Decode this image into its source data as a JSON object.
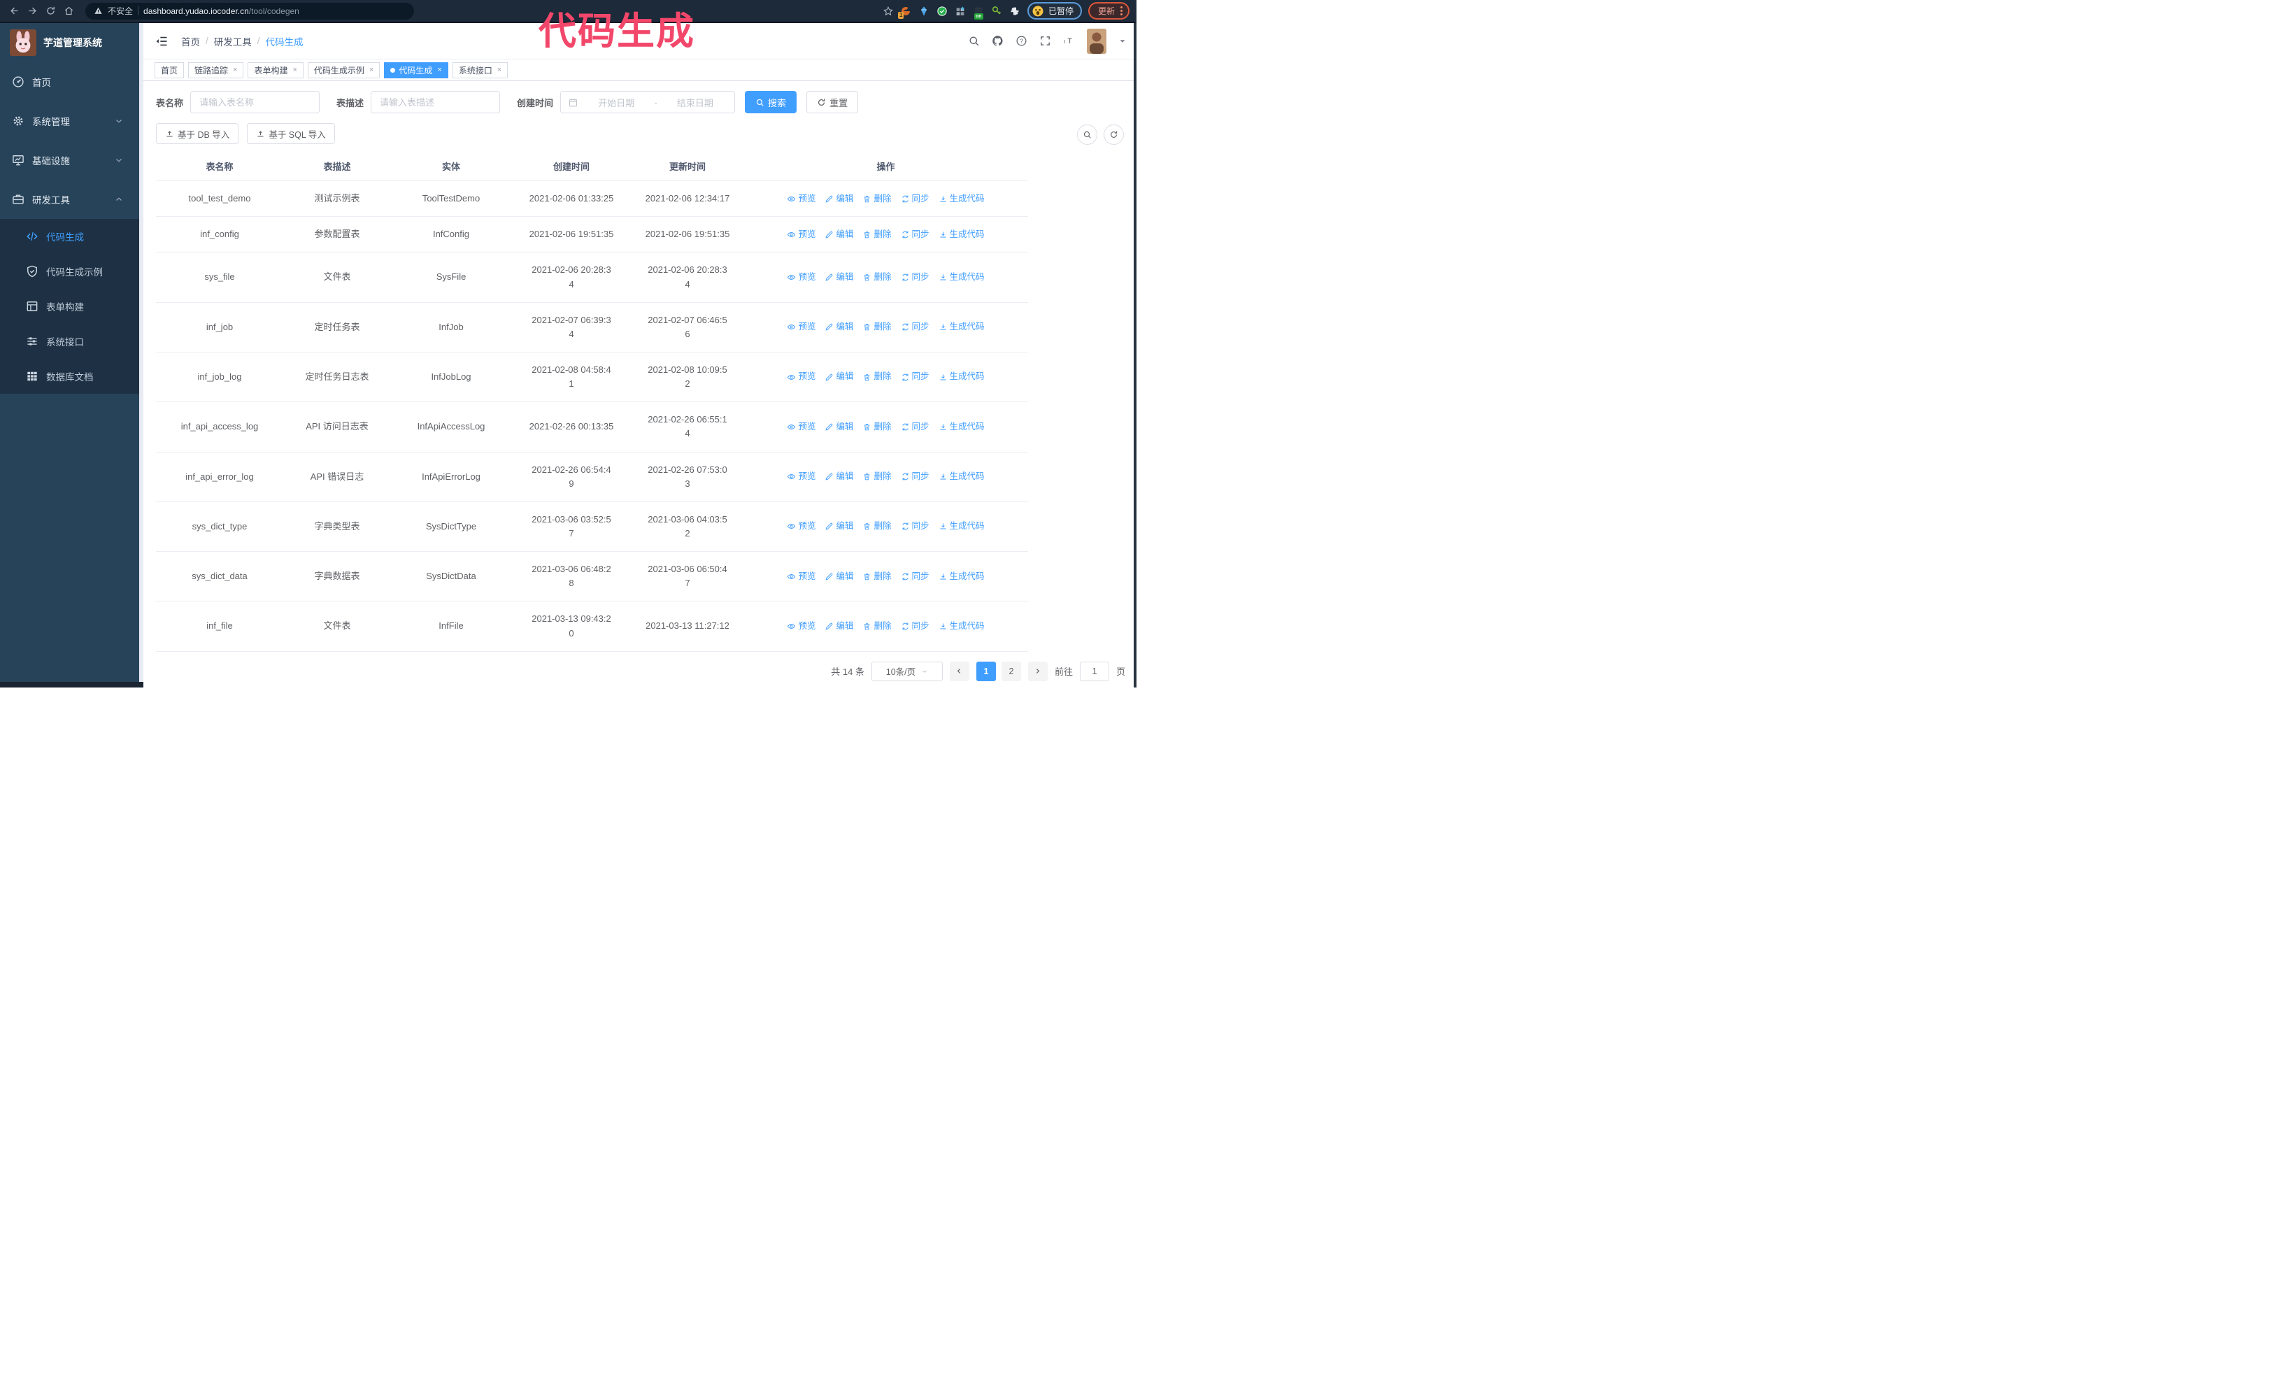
{
  "colors": {
    "accent": "#409EFF",
    "annotation": "#f2476a",
    "chrome": "#1d2a39",
    "sidebar": "#274359",
    "submenu": "#1e3144"
  },
  "annotation": {
    "text": "代码生成"
  },
  "browser": {
    "security_label": "不安全",
    "url_host": "dashboard.yudao.iocoder.cn",
    "url_path": "/tool/codegen",
    "extension_badge": "1",
    "extension_on_badge": "on",
    "paused_chip": "已暂停",
    "update_button": "更新"
  },
  "sidebar": {
    "logo_title": "芋道管理系统",
    "items": [
      {
        "label": "首页",
        "icon": "dashboard",
        "chevron": ""
      },
      {
        "label": "系统管理",
        "icon": "gear",
        "chevron": "down"
      },
      {
        "label": "基础设施",
        "icon": "monitor",
        "chevron": "down"
      },
      {
        "label": "研发工具",
        "icon": "toolbox",
        "chevron": "up"
      }
    ],
    "subitems": [
      {
        "label": "代码生成",
        "icon": "code",
        "active": true
      },
      {
        "label": "代码生成示例",
        "icon": "shield",
        "active": false
      },
      {
        "label": "表单构建",
        "icon": "form",
        "active": false
      },
      {
        "label": "系统接口",
        "icon": "sliders",
        "active": false
      },
      {
        "label": "数据库文档",
        "icon": "database",
        "active": false
      }
    ]
  },
  "breadcrumb": [
    "首页",
    "研发工具",
    "代码生成"
  ],
  "tabs": [
    {
      "label": "首页",
      "closable": false,
      "active": false
    },
    {
      "label": "链路追踪",
      "closable": true,
      "active": false
    },
    {
      "label": "表单构建",
      "closable": true,
      "active": false
    },
    {
      "label": "代码生成示例",
      "closable": true,
      "active": false
    },
    {
      "label": "代码生成",
      "closable": true,
      "active": true
    },
    {
      "label": "系统接口",
      "closable": true,
      "active": false
    }
  ],
  "filters": {
    "name_label": "表名称",
    "name_placeholder": "请输入表名称",
    "desc_label": "表描述",
    "desc_placeholder": "请输入表描述",
    "time_label": "创建时间",
    "start_placeholder": "开始日期",
    "range_separator": "-",
    "end_placeholder": "结束日期",
    "search_label": "搜索",
    "reset_label": "重置"
  },
  "toolbar": {
    "db_import": "基于 DB 导入",
    "sql_import": "基于 SQL 导入"
  },
  "table": {
    "headers": [
      "表名称",
      "表描述",
      "实体",
      "创建时间",
      "更新时间",
      "操作"
    ],
    "actions": [
      {
        "label": "预览",
        "icon": "eye"
      },
      {
        "label": "编辑",
        "icon": "edit"
      },
      {
        "label": "删除",
        "icon": "delete"
      },
      {
        "label": "同步",
        "icon": "sync"
      },
      {
        "label": "生成代码",
        "icon": "download"
      }
    ],
    "rows": [
      {
        "name": "tool_test_demo",
        "desc": "测试示例表",
        "entity": "ToolTestDemo",
        "created": [
          "2021-02-06 01:33:25"
        ],
        "updated": [
          "2021-02-06 12:34:17"
        ]
      },
      {
        "name": "inf_config",
        "desc": "参数配置表",
        "entity": "InfConfig",
        "created": [
          "2021-02-06 19:51:35"
        ],
        "updated": [
          "2021-02-06 19:51:35"
        ]
      },
      {
        "name": "sys_file",
        "desc": "文件表",
        "entity": "SysFile",
        "created": [
          "2021-02-06 20:28:3",
          "4"
        ],
        "updated": [
          "2021-02-06 20:28:3",
          "4"
        ]
      },
      {
        "name": "inf_job",
        "desc": "定时任务表",
        "entity": "InfJob",
        "created": [
          "2021-02-07 06:39:3",
          "4"
        ],
        "updated": [
          "2021-02-07 06:46:5",
          "6"
        ]
      },
      {
        "name": "inf_job_log",
        "desc": "定时任务日志表",
        "entity": "InfJobLog",
        "created": [
          "2021-02-08 04:58:4",
          "1"
        ],
        "updated": [
          "2021-02-08 10:09:5",
          "2"
        ]
      },
      {
        "name": "inf_api_access_log",
        "desc": "API 访问日志表",
        "entity": "InfApiAccessLog",
        "created": [
          "2021-02-26 00:13:35"
        ],
        "updated": [
          "2021-02-26 06:55:1",
          "4"
        ]
      },
      {
        "name": "inf_api_error_log",
        "desc": "API 错误日志",
        "entity": "InfApiErrorLog",
        "created": [
          "2021-02-26 06:54:4",
          "9"
        ],
        "updated": [
          "2021-02-26 07:53:0",
          "3"
        ]
      },
      {
        "name": "sys_dict_type",
        "desc": "字典类型表",
        "entity": "SysDictType",
        "created": [
          "2021-03-06 03:52:5",
          "7"
        ],
        "updated": [
          "2021-03-06 04:03:5",
          "2"
        ]
      },
      {
        "name": "sys_dict_data",
        "desc": "字典数据表",
        "entity": "SysDictData",
        "created": [
          "2021-03-06 06:48:2",
          "8"
        ],
        "updated": [
          "2021-03-06 06:50:4",
          "7"
        ]
      },
      {
        "name": "inf_file",
        "desc": "文件表",
        "entity": "InfFile",
        "created": [
          "2021-03-13 09:43:2",
          "0"
        ],
        "updated": [
          "2021-03-13 11:27:12"
        ]
      }
    ]
  },
  "pagination": {
    "total": "共 14 条",
    "page_size": "10条/页",
    "pages": [
      "1",
      "2"
    ],
    "active_page": "1",
    "goto_label": "前往",
    "goto_value": "1",
    "page_label": "页"
  }
}
